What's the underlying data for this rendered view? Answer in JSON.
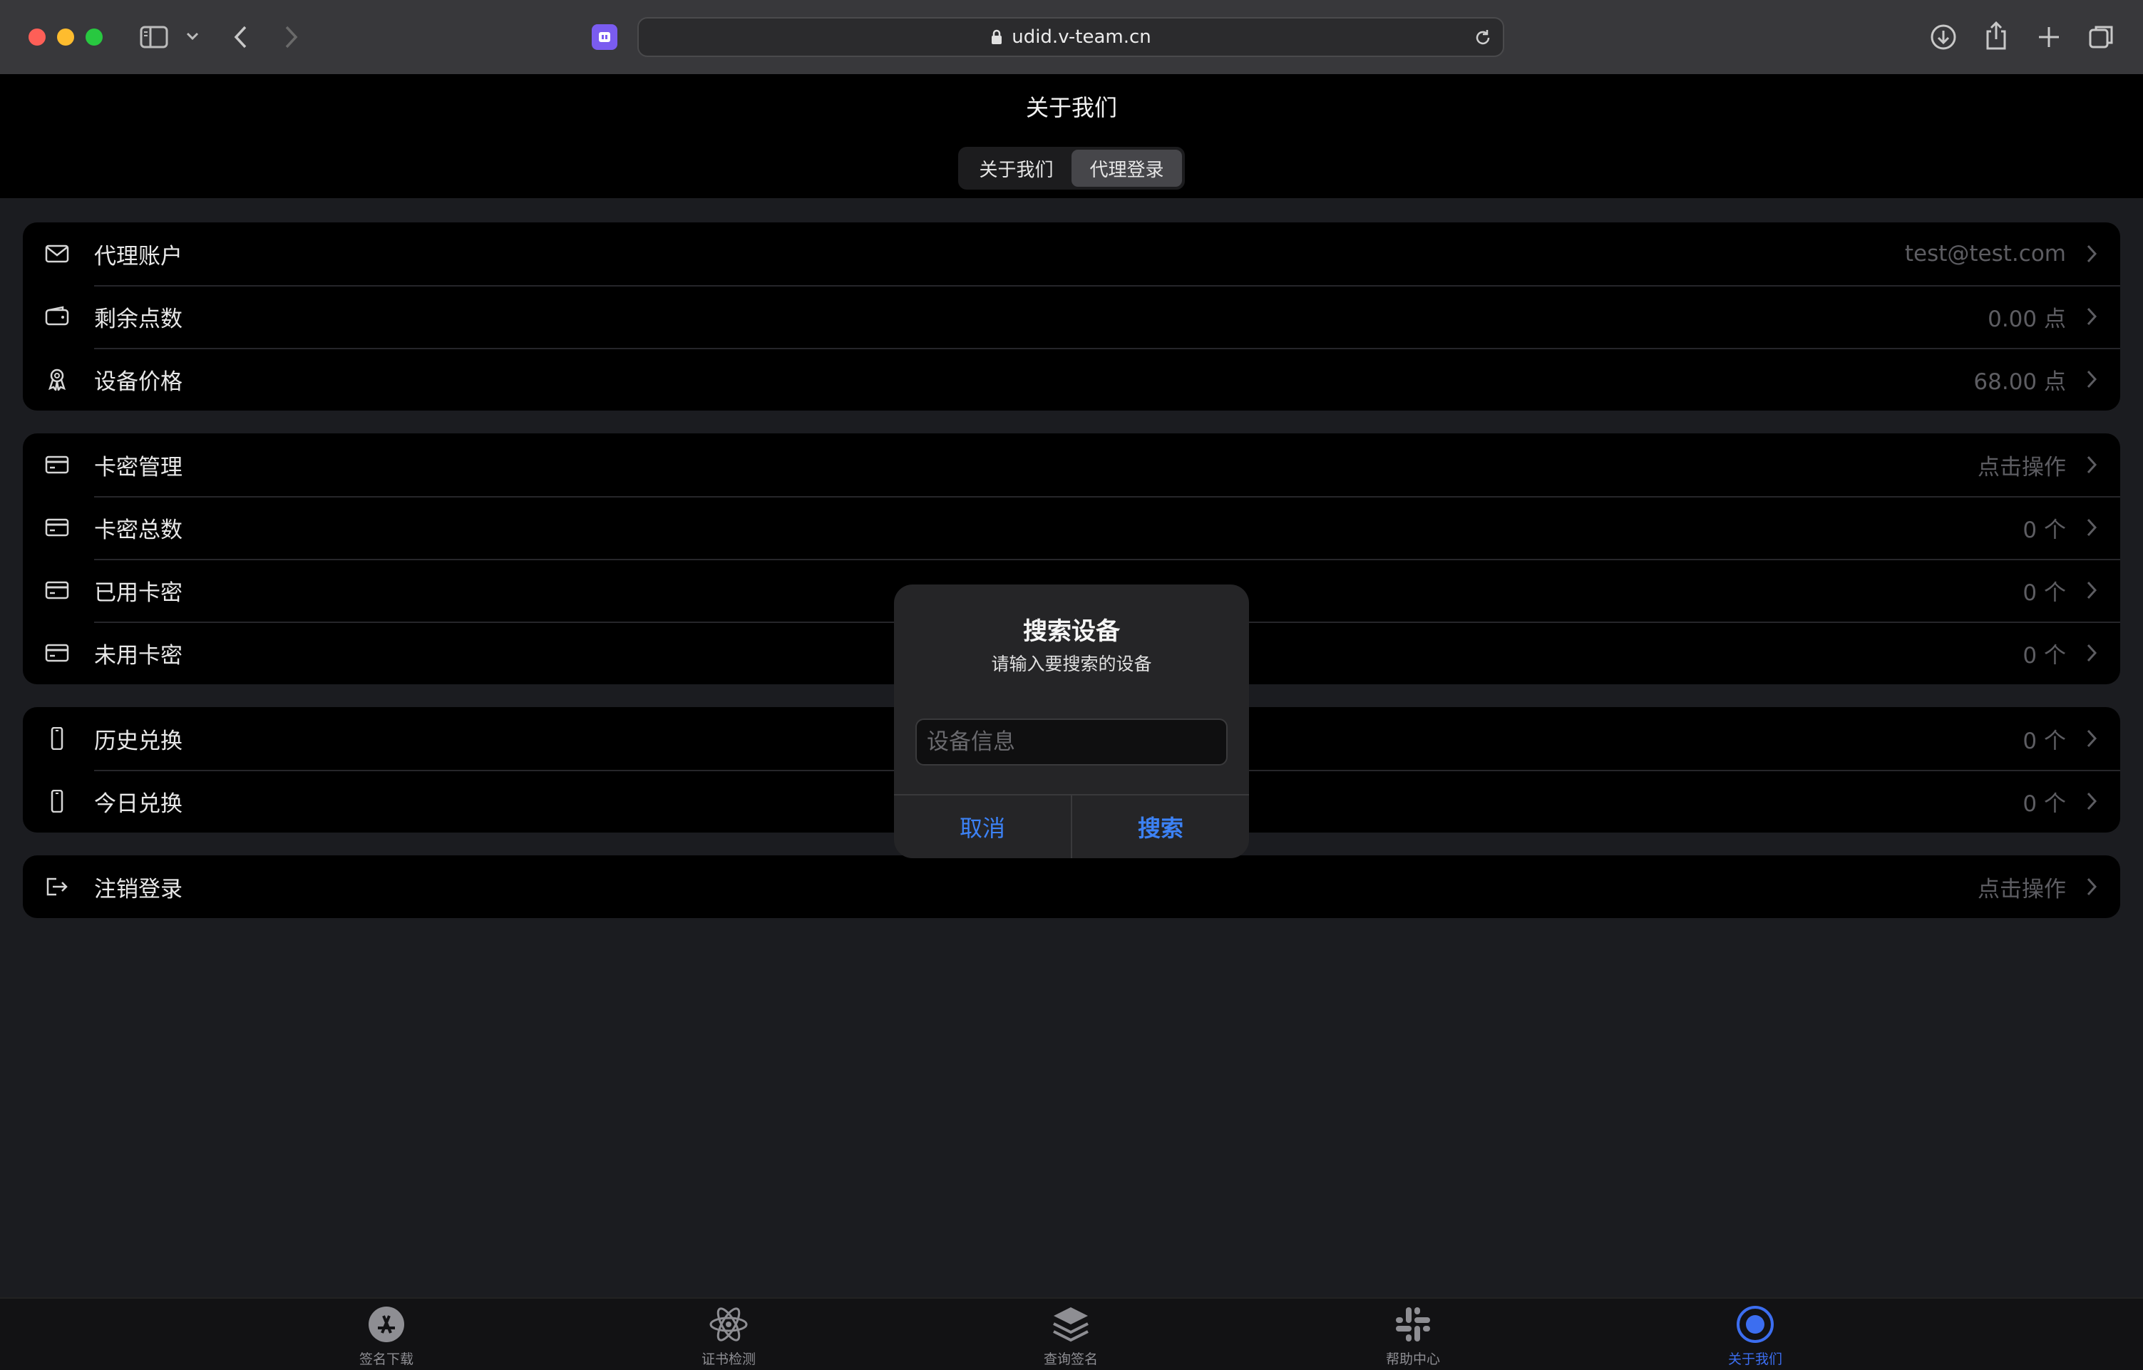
{
  "browser": {
    "url": "udid.v-team.cn"
  },
  "header": {
    "title": "关于我们",
    "segments": [
      {
        "label": "关于我们",
        "active": false
      },
      {
        "label": "代理登录",
        "active": true
      }
    ]
  },
  "groups": [
    {
      "rows": [
        {
          "label": "代理账户",
          "value": "test@test.com",
          "icon": "mail-icon"
        },
        {
          "label": "剩余点数",
          "value": "0.00 点",
          "icon": "wallet-icon"
        },
        {
          "label": "设备价格",
          "value": "68.00 点",
          "icon": "ribbon-icon"
        }
      ]
    },
    {
      "rows": [
        {
          "label": "卡密管理",
          "value": "点击操作",
          "icon": "card-icon"
        },
        {
          "label": "卡密总数",
          "value": "0 个",
          "icon": "card-icon"
        },
        {
          "label": "已用卡密",
          "value": "0 个",
          "icon": "card-icon"
        },
        {
          "label": "未用卡密",
          "value": "0 个",
          "icon": "card-icon"
        }
      ]
    },
    {
      "rows": [
        {
          "label": "历史兑换",
          "value": "0 个",
          "icon": "phone-icon"
        },
        {
          "label": "今日兑换",
          "value": "0 个",
          "icon": "phone-icon"
        }
      ]
    },
    {
      "rows": [
        {
          "label": "注销登录",
          "value": "点击操作",
          "icon": "logout-icon"
        }
      ]
    }
  ],
  "dialog": {
    "title": "搜索设备",
    "message": "请输入要搜索的设备",
    "input_value": "",
    "input_placeholder": "设备信息",
    "cancel_label": "取消",
    "confirm_label": "搜索"
  },
  "tabbar": {
    "items": [
      {
        "label": "签名下载",
        "icon": "app-store-icon",
        "active": false
      },
      {
        "label": "证书检测",
        "icon": "atom-icon",
        "active": false
      },
      {
        "label": "查询签名",
        "icon": "layers-icon",
        "active": false
      },
      {
        "label": "帮助中心",
        "icon": "slack-icon",
        "active": false
      },
      {
        "label": "关于我们",
        "icon": "target-icon",
        "active": true
      }
    ]
  },
  "colors": {
    "accent": "#3c82f6",
    "page_bg": "#1b1c20",
    "card_bg": "#000000",
    "muted_value": "#5d5d62"
  }
}
